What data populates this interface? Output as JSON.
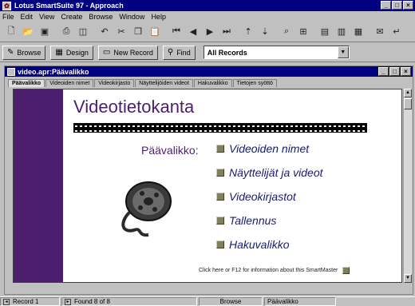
{
  "app": {
    "title": "Lotus SmartSuite 97 - Approach",
    "window_buttons": [
      "_",
      "□",
      "×"
    ]
  },
  "menu": [
    "File",
    "Edit",
    "View",
    "Create",
    "Browse",
    "Window",
    "Help"
  ],
  "toolbar": {
    "icons": [
      "new-file-icon",
      "open-file-icon",
      "save-icon",
      "print-icon",
      "preview-icon",
      "undo-icon",
      "cut-icon",
      "copy-icon",
      "paste-icon",
      "first-record-icon",
      "prev-record-icon",
      "next-record-icon",
      "last-record-icon",
      "sort-asc-icon",
      "sort-desc-icon",
      "find-icon",
      "find-all-icon",
      "chart-icon",
      "report-icon",
      "form-icon",
      "mail-icon",
      "enter-icon"
    ]
  },
  "actionbar": {
    "browse_label": "Browse",
    "design_label": "Design",
    "new_record_label": "New Record",
    "find_label": "Find",
    "find_select_value": "All Records"
  },
  "document": {
    "title": "video.apr:Päävalikko",
    "tabs": [
      "Päävalikko",
      "Videoiden nimet",
      "Videokirjasto",
      "Näyttelijöiden videot",
      "Hakuvalikko",
      "Tietojen syöttö"
    ]
  },
  "form": {
    "heading": "Videotietokanta",
    "menu_label": "Päävalikko:",
    "items": [
      "Videoiden nimet",
      "Näyttelijät ja videot",
      "Videokirjastot",
      "Tallennus",
      "Hakuvalikko"
    ],
    "info_text": "Click here or F12 for information about this SmartMaster"
  },
  "status": {
    "record": "Record 1",
    "found": "Found 8 of 8",
    "mode": "Browse",
    "view": "Päävalikko"
  },
  "colors": {
    "accent": "#4b1f6e",
    "titlebar": "#000080"
  }
}
